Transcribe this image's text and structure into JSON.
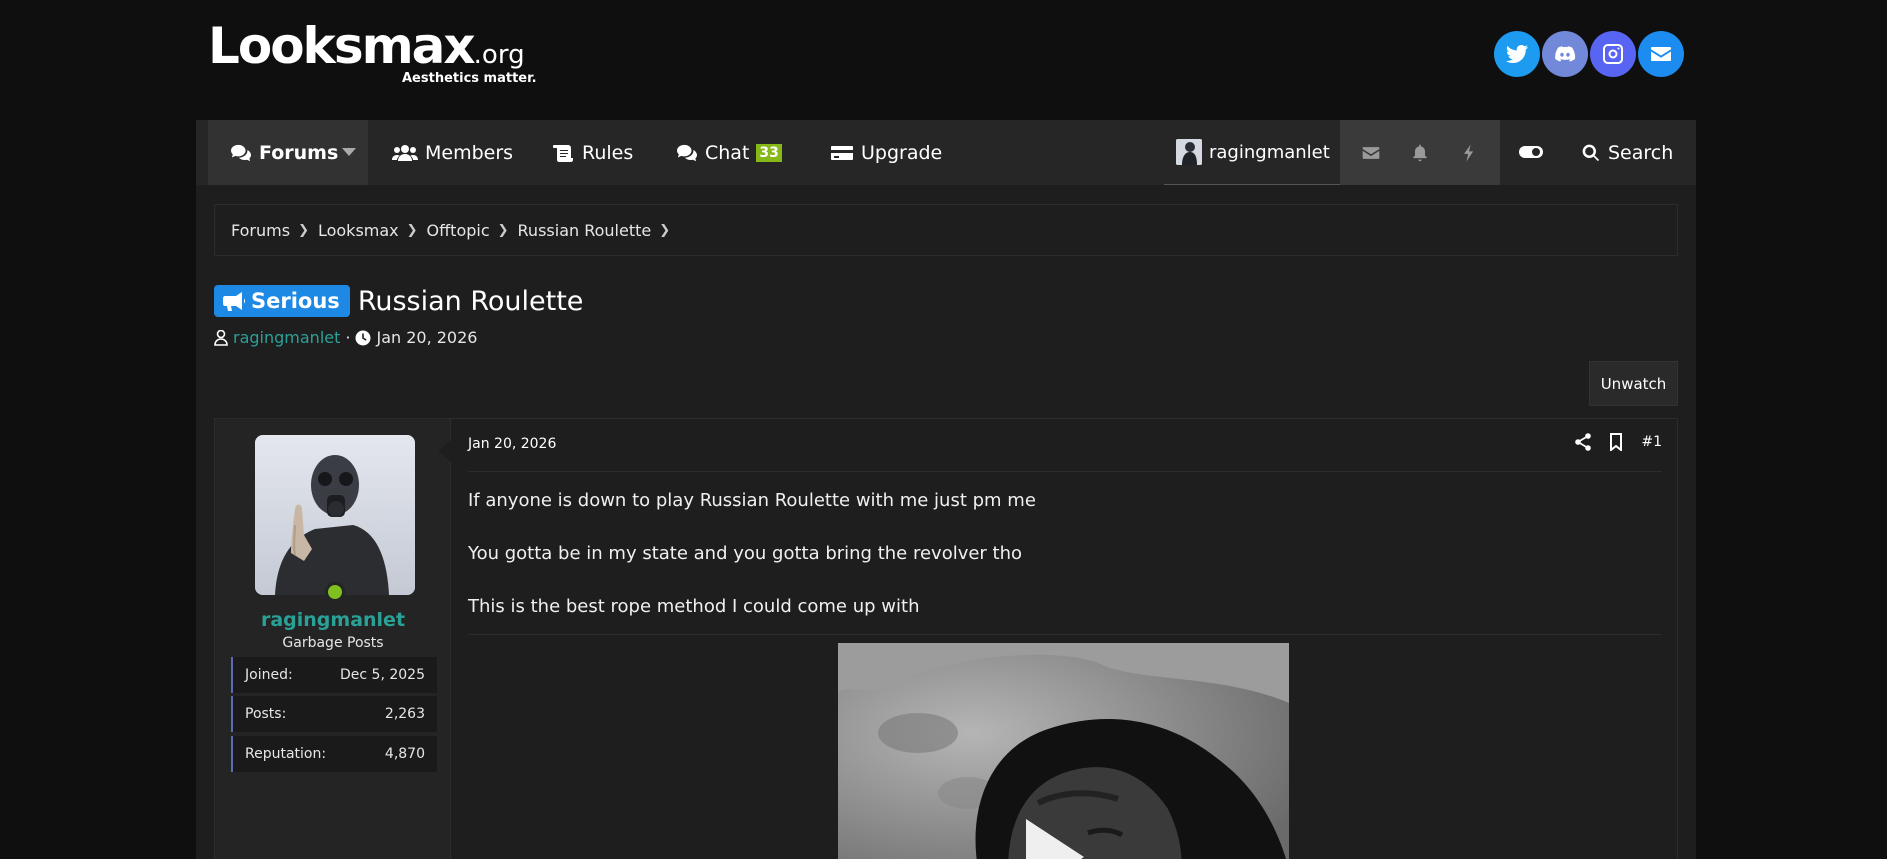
{
  "header": {
    "logo_text": "Looksmax",
    "logo_tld": ".org",
    "tagline": "Aesthetics matter.",
    "socials": [
      {
        "icon": "twitter-icon",
        "color": "#1d9bf0"
      },
      {
        "icon": "discord-icon",
        "color": "#7289da"
      },
      {
        "icon": "instagram-icon",
        "color": "#5865f2"
      },
      {
        "icon": "email-icon",
        "color": "#1d8cf0"
      }
    ]
  },
  "nav": {
    "forums": "Forums",
    "members": "Members",
    "rules": "Rules",
    "chat": "Chat",
    "chat_badge": "33",
    "upgrade": "Upgrade",
    "username": "ragingmanlet",
    "search": "Search"
  },
  "breadcrumb": [
    "Forums",
    "Looksmax",
    "Offtopic",
    "Russian Roulette"
  ],
  "thread": {
    "prefix": "Serious",
    "title": "Russian Roulette",
    "author": "ragingmanlet",
    "date": "Jan 20, 2026",
    "unwatch_label": "Unwatch"
  },
  "post": {
    "username": "ragingmanlet",
    "user_title": "Garbage Posts",
    "stats": [
      {
        "label": "Joined:",
        "value": "Dec 5, 2025"
      },
      {
        "label": "Posts:",
        "value": "2,263"
      },
      {
        "label": "Reputation:",
        "value": "4,870"
      }
    ],
    "date": "Jan 20, 2026",
    "number": "#1",
    "paragraphs": [
      "If anyone is down to play Russian Roulette with me just pm me",
      "You gotta be in my state and you gotta bring the revolver tho",
      "This is the best rope method I could come up with"
    ]
  },
  "colors": {
    "accent": "#2aa197",
    "prefix": "#1e88e5",
    "badge": "#86b817",
    "online": "#7fbf1f"
  }
}
